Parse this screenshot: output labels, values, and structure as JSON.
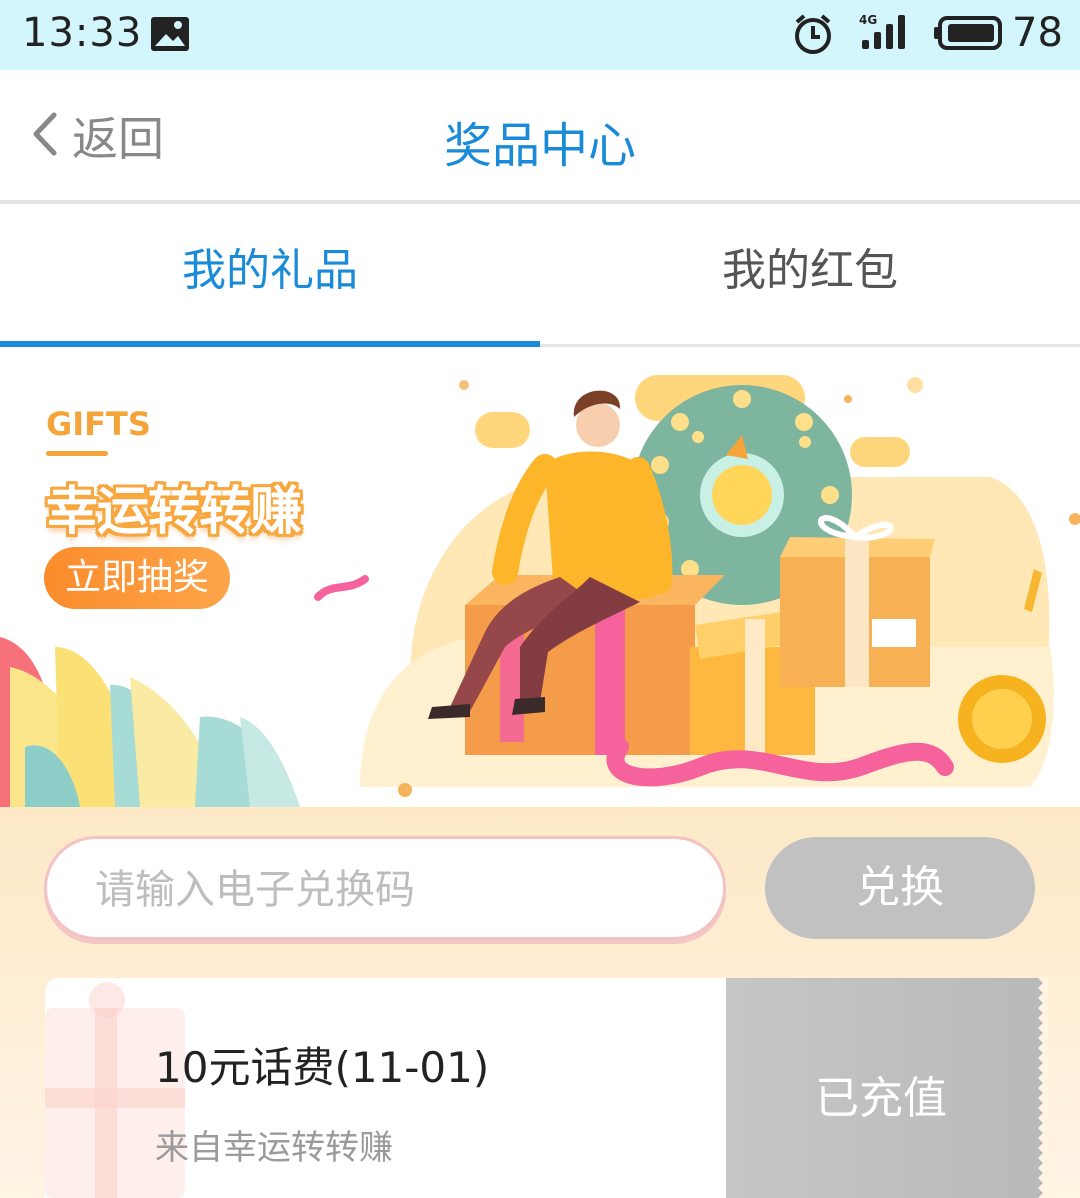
{
  "status_bar": {
    "time": "13:33",
    "network": "4G",
    "battery": "78"
  },
  "nav": {
    "back_label": "返回",
    "title": "奖品中心"
  },
  "tabs": [
    {
      "label": "我的礼品",
      "active": true
    },
    {
      "label": "我的红包",
      "active": false
    }
  ],
  "banner": {
    "tag": "GIFTS",
    "slogan": "幸运转转赚",
    "button_label": "立即抽奖"
  },
  "redeem": {
    "placeholder": "请输入电子兑换码",
    "value": "",
    "button_label": "兑换"
  },
  "prizes": [
    {
      "title": "10元话费(11-01)",
      "source": "来自幸运转转赚",
      "status": "已充值"
    }
  ],
  "colors": {
    "accent": "#1a8bd8",
    "orange": "#fb8c2c",
    "disabled": "#c1c1c1"
  }
}
